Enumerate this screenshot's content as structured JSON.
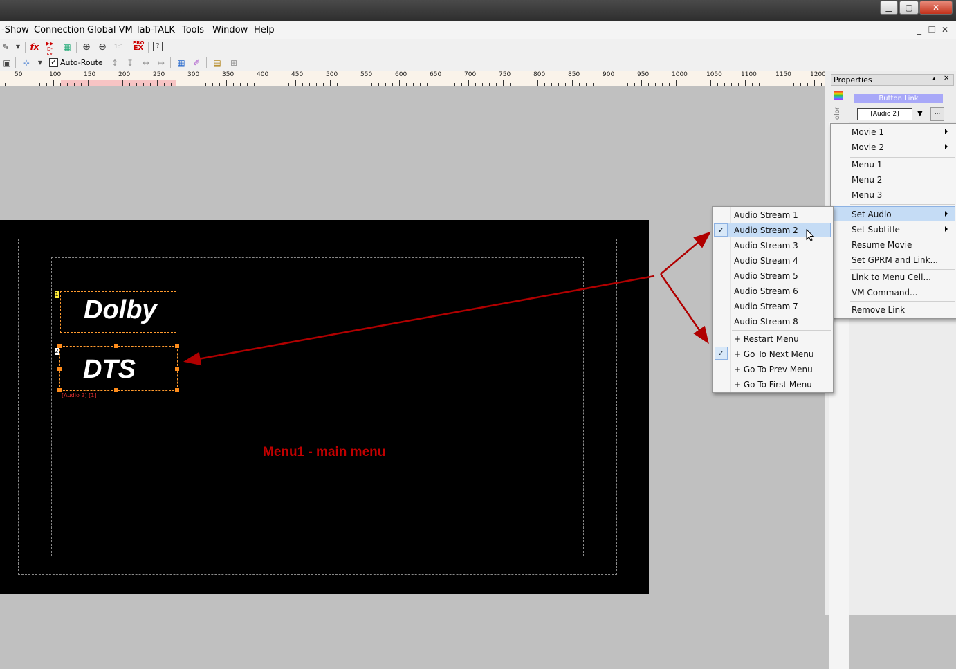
{
  "menubar": {
    "items": [
      "-Show",
      "Connection",
      "Global VM",
      "lab-TALK",
      "Tools",
      "Window",
      "Help"
    ],
    "mdi_controls": [
      "_",
      "❐",
      "✕"
    ]
  },
  "window_controls": {
    "minimize": "▁",
    "restore": "▢",
    "close": "✕"
  },
  "toolbar": {
    "fx": "fx",
    "dfx": "D-FX",
    "one_to_one": "1:1",
    "pro_ex_top": "PRO",
    "pro_ex_bottom": "EX",
    "auto_route": "Auto-Route",
    "auto_route_checked": true
  },
  "ruler": {
    "labels": [
      "50",
      "100",
      "150",
      "200",
      "250",
      "300",
      "350",
      "400",
      "450",
      "500",
      "550",
      "600",
      "650",
      "700",
      "750",
      "800",
      "850",
      "900",
      "950",
      "1000",
      "1050",
      "1100",
      "1150",
      "1200"
    ]
  },
  "canvas": {
    "buttons": [
      {
        "number": "1",
        "text": "Dolby"
      },
      {
        "number": "2",
        "text": "DTS"
      }
    ],
    "link_label": "[Audio 2] [1]",
    "menu_title": "Menu1 - main menu"
  },
  "properties": {
    "title": "Properties",
    "pin": "▴",
    "close": "✕",
    "side_tab": "olor",
    "button_link_label": "Button Link",
    "link_value": "[Audio 2]",
    "more_button": "..."
  },
  "context_menu": {
    "items": [
      {
        "label": "Movie 1",
        "submenu": true
      },
      {
        "label": "Movie 2",
        "submenu": true
      },
      {
        "label": "Menu 1",
        "submenu": false
      },
      {
        "label": "Menu 2",
        "submenu": false
      },
      {
        "label": "Menu 3",
        "submenu": false
      },
      {
        "label": "Set Audio",
        "submenu": true,
        "highlighted": true
      },
      {
        "label": "Set Subtitle",
        "submenu": true
      },
      {
        "label": "Resume Movie",
        "submenu": false
      },
      {
        "label": "Set GPRM and Link...",
        "submenu": false
      },
      {
        "label": "Link to Menu Cell...",
        "submenu": false
      },
      {
        "label": "VM Command...",
        "submenu": false
      },
      {
        "label": "Remove Link",
        "submenu": false
      }
    ]
  },
  "audio_submenu": {
    "items": [
      {
        "label": "Audio Stream 1",
        "checked": false
      },
      {
        "label": "Audio Stream 2",
        "checked": true,
        "highlighted": true
      },
      {
        "label": "Audio Stream 3",
        "checked": false
      },
      {
        "label": "Audio Stream 4",
        "checked": false
      },
      {
        "label": "Audio Stream 5",
        "checked": false
      },
      {
        "label": "Audio Stream 6",
        "checked": false
      },
      {
        "label": "Audio Stream 7",
        "checked": false
      },
      {
        "label": "Audio Stream 8",
        "checked": false
      },
      {
        "label": "+ Restart Menu",
        "checked": false
      },
      {
        "label": "+ Go To Next Menu",
        "checked": true
      },
      {
        "label": "+ Go To Prev Menu",
        "checked": false
      },
      {
        "label": "+ Go To First Menu",
        "checked": false
      }
    ],
    "check_glyph": "✓"
  },
  "colors": {
    "accent_red": "#b00000",
    "highlight": "#c5dcf5",
    "button_outline": "#ff9a2e"
  }
}
